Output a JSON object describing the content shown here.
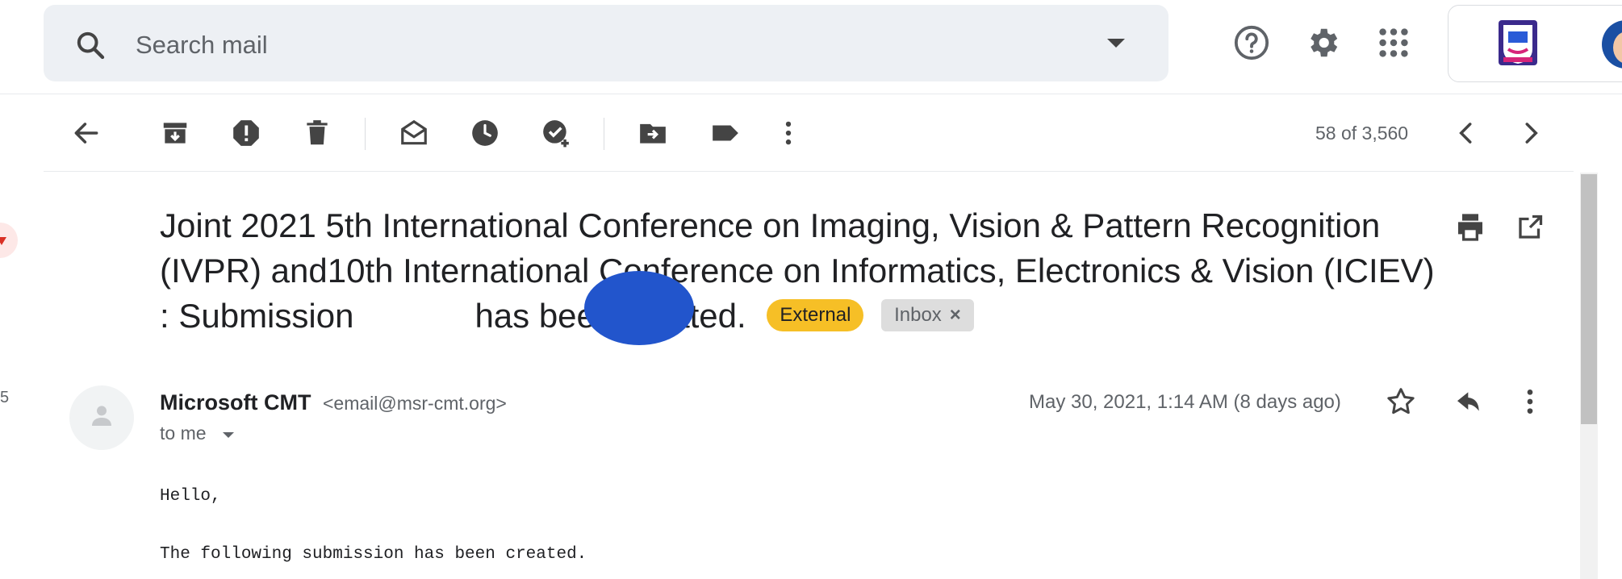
{
  "search": {
    "placeholder": "Search mail"
  },
  "toolbar": {
    "pager": "58 of 3,560"
  },
  "message": {
    "subject": "Joint 2021 5th International Conference on Imaging, Vision & Pattern Recognition (IVPR) and10th International Conference on Informatics, Electronics & Vision (ICIEV) : Submission",
    "subject_end": "has been created.",
    "labels": {
      "external": "External",
      "inbox": "Inbox",
      "inbox_remove": "×"
    },
    "sender_name": "Microsoft CMT",
    "sender_email": "<email@msr-cmt.org>",
    "recipient": "to me",
    "date": "May 30, 2021, 1:14 AM (8 days ago)",
    "body": {
      "line1": "Hello,",
      "line2": "The following submission has been created."
    }
  },
  "left_fragment": {
    "number": "5"
  },
  "colors": {
    "external_chip": "#f6bf26",
    "redaction": "#2255cc",
    "avatar": "#1a4fa3"
  }
}
